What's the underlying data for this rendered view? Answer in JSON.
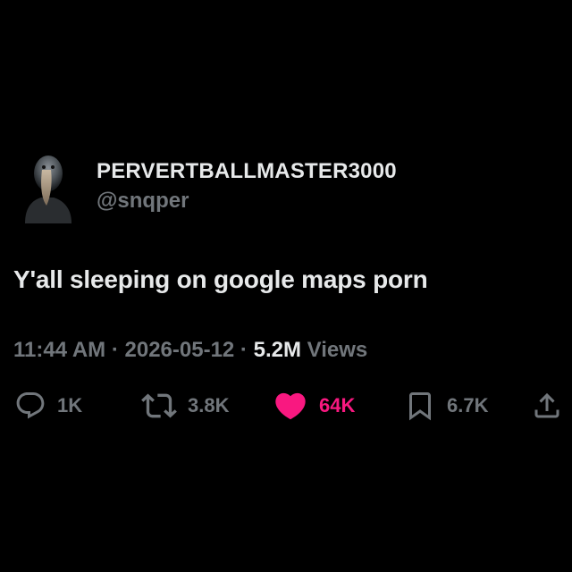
{
  "user": {
    "display_name": "PERVERTBALLMASTER3000",
    "handle": "@snqper",
    "avatar_icon": "shoebill-bird-avatar"
  },
  "tweet": {
    "text": "Y'all sleeping on google maps porn",
    "time": "11:44 AM",
    "separator1": " · ",
    "date": "2026-05-12",
    "separator2": " · ",
    "views_count": "5.2M",
    "views_label": " Views"
  },
  "actions": {
    "reply": {
      "icon": "reply-icon",
      "count": "1K"
    },
    "retweet": {
      "icon": "retweet-icon",
      "count": "3.8K"
    },
    "like": {
      "icon": "heart-icon",
      "count": "64K",
      "liked": true
    },
    "bookmark": {
      "icon": "bookmark-icon",
      "count": "6.7K"
    },
    "share": {
      "icon": "share-icon"
    }
  },
  "colors": {
    "background": "#000000",
    "primary_text": "#e7e9ea",
    "secondary_text": "#71767b",
    "like_pink": "#f91880"
  }
}
